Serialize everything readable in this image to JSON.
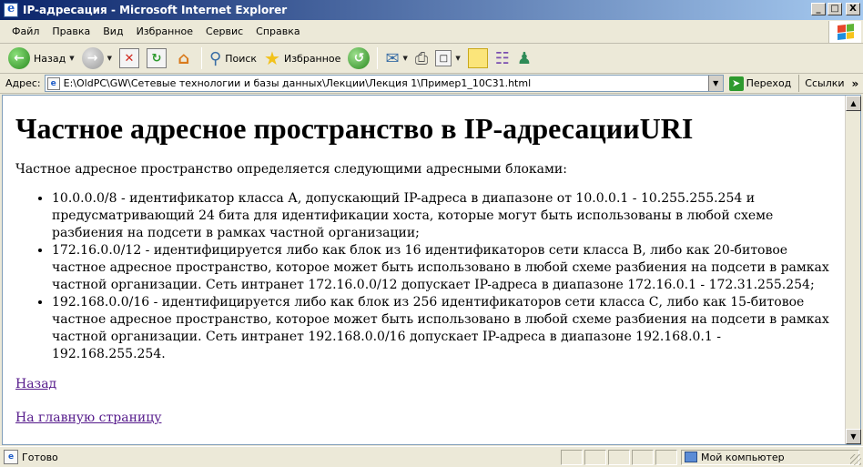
{
  "window": {
    "title": "IP-адресация - Microsoft Internet Explorer",
    "minimize": "_",
    "maximize": "□",
    "close": "X"
  },
  "menu": {
    "items": [
      "Файл",
      "Правка",
      "Вид",
      "Избранное",
      "Сервис",
      "Справка"
    ]
  },
  "toolbar": {
    "back_label": "Назад",
    "search_label": "Поиск",
    "favorites_label": "Избранное"
  },
  "address": {
    "label": "Адрес:",
    "url": "E:\\OldPC\\GW\\Сетевые технологии и базы данных\\Лекции\\Лекция 1\\Пример1_10C31.html",
    "go_label": "Переход",
    "links_label": "Ссылки",
    "chevron": "»"
  },
  "page": {
    "heading": "Частное адресное пространство в IP-адресацииURI",
    "intro": "Частное адресное пространство определяется следующими адресными блоками:",
    "blocks": [
      "10.0.0.0/8 - идентификатор класса А, допускающий IP-адреса в диапазоне от 10.0.0.1 - 10.255.255.254 и предусматривающий 24 бита для идентификации хоста, которые могут быть использованы в любой схеме разбиения на подсети в рамках частной организации;",
      "172.16.0.0/12 - идентифицируется либо как блок из 16 идентификаторов сети класса В, либо как 20-битовое частное адресное пространство, которое может быть использовано в любой схеме разбиения на подсети в рамках частной организации. Сеть интранет 172.16.0.0/12 допускает IP-адреса в диапазоне 172.16.0.1 - 172.31.255.254;",
      "192.168.0.0/16 - идентифицируется либо как блок из 256 идентификаторов сети класса С, либо как 15-битовое частное адресное пространство, которое может быть использовано в любой схеме разбиения на подсети в рамках частной организации. Сеть интранет 192.168.0.0/16 допускает IP-адреса в диапазоне 192.168.0.1 - 192.168.255.254."
    ],
    "link_back": "Назад",
    "link_home": "На главную страницу"
  },
  "status": {
    "text": "Готово",
    "zone": "Мой компьютер"
  },
  "colors": {
    "titlebar": "#0a246a",
    "link_visited": "#551a8b",
    "chrome": "#ece9d8"
  }
}
